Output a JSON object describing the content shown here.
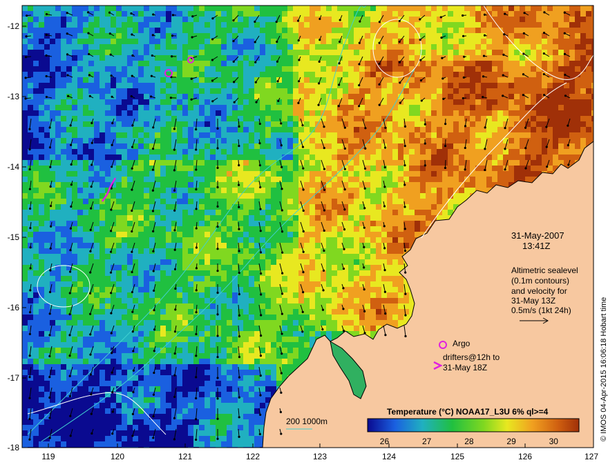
{
  "map": {
    "lon_ticks": [
      "119",
      "120",
      "121",
      "122",
      "123",
      "124",
      "125",
      "126",
      "127"
    ],
    "lat_ticks": [
      "-12",
      "-13",
      "-14",
      "-15",
      "-16",
      "-17",
      "-18"
    ],
    "extent": {
      "lon": [
        118.6,
        127.0
      ],
      "lat": [
        -18.0,
        -11.7
      ]
    },
    "date": "31-May-2007",
    "time": "13:41Z"
  },
  "annotations": {
    "altimetry": [
      "Altimetric sealevel",
      "(0.1m contours)",
      "and velocity for",
      "31-May 13Z"
    ],
    "velocity_scale": "0.5m/s (1kt 24h)",
    "argo": "Argo",
    "drifters_line1": "drifters@12h to",
    "drifters_line2": "31-May 18Z",
    "isobaths": "200  1000m"
  },
  "colorbar": {
    "title": "Temperature (°C) NOAA17_L3U 6% ql>=4",
    "ticks": [
      "26",
      "27",
      "28",
      "29",
      "30"
    ],
    "range": [
      25.6,
      30.6
    ]
  },
  "credit": "© IMOS 04-Apr-2015 16:06:18 Hobart time",
  "colors": {
    "land": "#f7c8a0",
    "argo": "#e020e0",
    "isobath": "#40d0d0",
    "contour": "#ffffff",
    "colormap": [
      "#0a0a90",
      "#1a60e0",
      "#20b0c0",
      "#20c040",
      "#80d820",
      "#e8e820",
      "#f0a020",
      "#d06010",
      "#a03008"
    ]
  }
}
